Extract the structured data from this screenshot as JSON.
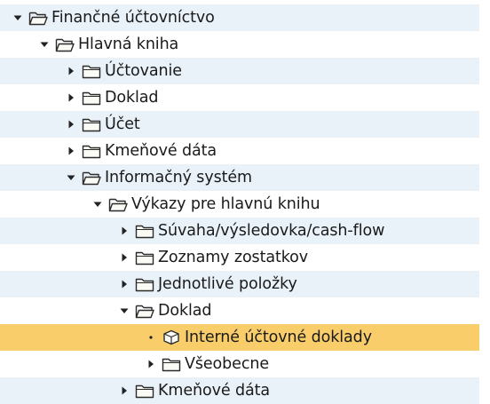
{
  "tree": {
    "items": [
      {
        "label": "Finančné účtovníctvo",
        "level": 0,
        "state": "expanded",
        "icon": "folder-open-icon"
      },
      {
        "label": "Hlavná kniha",
        "level": 1,
        "state": "expanded",
        "icon": "folder-open-icon"
      },
      {
        "label": "Účtovanie",
        "level": 2,
        "state": "collapsed",
        "icon": "folder-icon"
      },
      {
        "label": "Doklad",
        "level": 2,
        "state": "collapsed",
        "icon": "folder-icon"
      },
      {
        "label": "Účet",
        "level": 2,
        "state": "collapsed",
        "icon": "folder-icon"
      },
      {
        "label": "Kmeňové dáta",
        "level": 2,
        "state": "collapsed",
        "icon": "folder-icon"
      },
      {
        "label": "Informačný systém",
        "level": 2,
        "state": "expanded",
        "icon": "folder-open-icon"
      },
      {
        "label": "Výkazy pre hlavnú knihu",
        "level": 3,
        "state": "expanded",
        "icon": "folder-open-icon"
      },
      {
        "label": "Súvaha/výsledovka/cash-flow",
        "level": 4,
        "state": "collapsed",
        "icon": "folder-icon"
      },
      {
        "label": "Zoznamy zostatkov",
        "level": 4,
        "state": "collapsed",
        "icon": "folder-icon"
      },
      {
        "label": "Jednotlivé položky",
        "level": 4,
        "state": "collapsed",
        "icon": "folder-icon"
      },
      {
        "label": "Doklad",
        "level": 4,
        "state": "expanded",
        "icon": "folder-open-icon"
      },
      {
        "label": "Interné účtovné doklady",
        "level": 5,
        "state": "leaf",
        "icon": "transaction-cube-icon",
        "selected": true
      },
      {
        "label": "Všeobecne",
        "level": 5,
        "state": "collapsed",
        "icon": "folder-icon"
      },
      {
        "label": "Kmeňové dáta",
        "level": 4,
        "state": "collapsed",
        "icon": "folder-icon"
      }
    ]
  },
  "colors": {
    "selected_bg": "#f8cd6a",
    "alt_row_bg": "#eaf2f9",
    "text": "#1a1a1a"
  }
}
